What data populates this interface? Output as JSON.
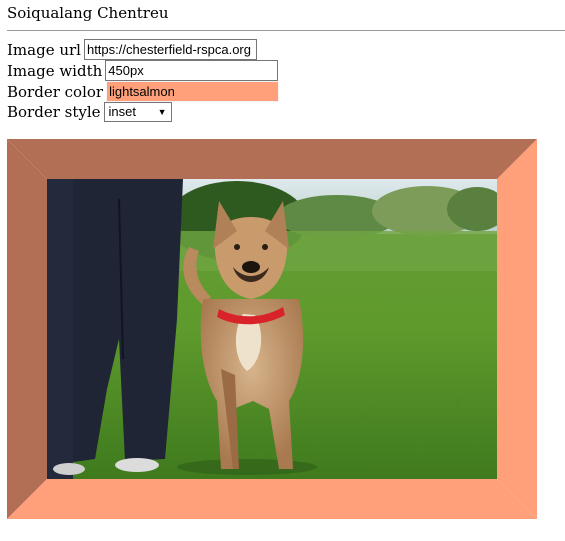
{
  "page": {
    "title": "Soiqualang Chentreu"
  },
  "form": {
    "url_label": "Image url",
    "url_value": "https://chesterfield-rspca.org",
    "width_label": "Image width",
    "width_value": "450px",
    "color_label": "Border color",
    "color_value": "lightsalmon",
    "style_label": "Border style",
    "style_value": "inset"
  },
  "colors": {
    "border_color": "#ffa07a",
    "border_dark": "#b36f56"
  },
  "image": {
    "subject": "tan dog with red collar standing on grass next to a person in dark trousers"
  }
}
